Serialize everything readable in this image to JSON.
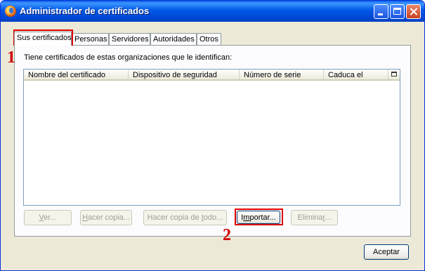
{
  "window": {
    "title": "Administrador de certificados"
  },
  "tabs": [
    {
      "label": "Sus certificados"
    },
    {
      "label": "Personas"
    },
    {
      "label": "Servidores"
    },
    {
      "label": "Autoridades"
    },
    {
      "label": "Otros"
    }
  ],
  "panel": {
    "description": "Tiene certificados de estas organizaciones que le identifican:",
    "columns": [
      {
        "label": "Nombre del certificado"
      },
      {
        "label": "Dispositivo de seguridad"
      },
      {
        "label": "Número de serie"
      },
      {
        "label": "Caduca el"
      }
    ]
  },
  "buttons": {
    "ver": {
      "pre": "",
      "key": "V",
      "post": "er..."
    },
    "hacer_copia": {
      "pre": "",
      "key": "H",
      "post": "acer copia..."
    },
    "hacer_copia_todo": {
      "pre": "Hacer copia de ",
      "key": "t",
      "post": "odo..."
    },
    "importar": {
      "pre": "I",
      "key": "m",
      "post": "portar..."
    },
    "eliminar": {
      "pre": "Elimina",
      "key": "r",
      "post": "..."
    },
    "aceptar": {
      "label": "Aceptar"
    }
  },
  "annotations": {
    "step1": "1",
    "step2": "2",
    "color": "#e00000"
  },
  "colors": {
    "titlebar": "#0058e6",
    "dialog_bg": "#ece9d8",
    "tab_border": "#919b9c"
  }
}
